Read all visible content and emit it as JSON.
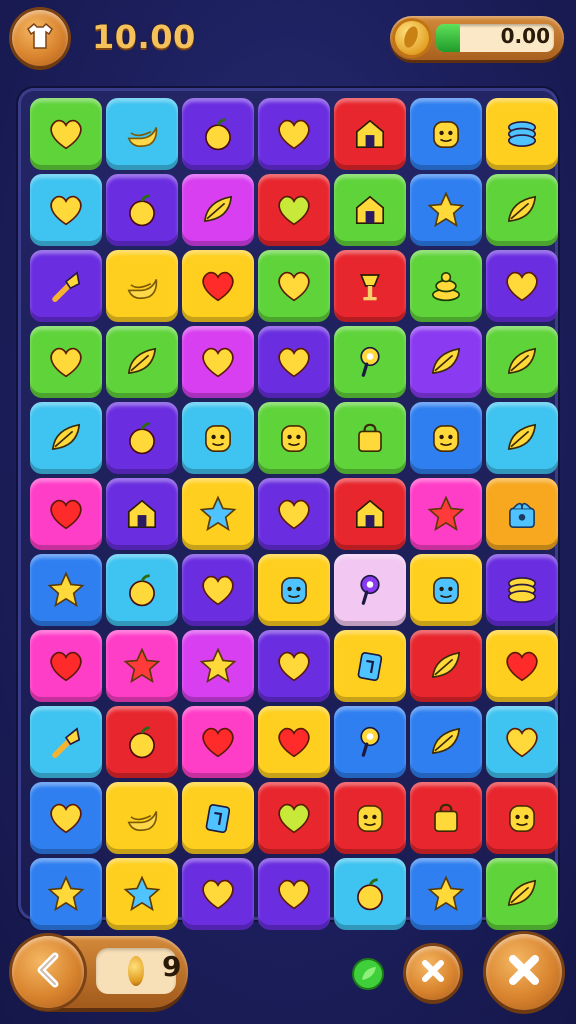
{
  "header": {
    "score": "10.00",
    "coins_value": "0.00",
    "coin_progress": 0.2
  },
  "footer": {
    "moves_remaining": "9"
  },
  "colors": {
    "green": "#5fd33a",
    "cyan": "#3fc3f0",
    "blue": "#2f7ff0",
    "purple": "#6a2ee0",
    "violet": "#8a3af0",
    "red": "#e8262e",
    "yellow": "#ffcf1f",
    "pink": "#ff3ec8",
    "magenta": "#d83ff0",
    "lightpink": "#f2c8f2",
    "orange": "#f7a81f"
  },
  "board": [
    [
      [
        "green",
        "heart"
      ],
      [
        "cyan",
        "banana"
      ],
      [
        "purple",
        "apple"
      ],
      [
        "purple",
        "heart"
      ],
      [
        "red",
        "house"
      ],
      [
        "blue",
        "face"
      ],
      [
        "yellow",
        "coil"
      ]
    ],
    [
      [
        "cyan",
        "heart"
      ],
      [
        "purple",
        "apple"
      ],
      [
        "magenta",
        "leaf"
      ],
      [
        "red",
        "heart"
      ],
      [
        "green",
        "house"
      ],
      [
        "blue",
        "star"
      ],
      [
        "green",
        "leaf"
      ]
    ],
    [
      [
        "purple",
        "wand"
      ],
      [
        "yellow",
        "banana"
      ],
      [
        "yellow",
        "heart"
      ],
      [
        "green",
        "heart"
      ],
      [
        "red",
        "lamp"
      ],
      [
        "green",
        "cake"
      ],
      [
        "purple",
        "heart"
      ]
    ],
    [
      [
        "green",
        "heart"
      ],
      [
        "green",
        "leaf"
      ],
      [
        "magenta",
        "heart"
      ],
      [
        "purple",
        "heart"
      ],
      [
        "green",
        "key"
      ],
      [
        "violet",
        "leaf"
      ],
      [
        "green",
        "leaf"
      ]
    ],
    [
      [
        "cyan",
        "leaf"
      ],
      [
        "purple",
        "apple"
      ],
      [
        "cyan",
        "face"
      ],
      [
        "green",
        "face"
      ],
      [
        "green",
        "bag"
      ],
      [
        "blue",
        "face"
      ],
      [
        "cyan",
        "leaf"
      ]
    ],
    [
      [
        "pink",
        "heart"
      ],
      [
        "purple",
        "house"
      ],
      [
        "yellow",
        "star"
      ],
      [
        "purple",
        "heart"
      ],
      [
        "red",
        "house"
      ],
      [
        "pink",
        "star"
      ],
      [
        "orange",
        "gift"
      ]
    ],
    [
      [
        "blue",
        "star"
      ],
      [
        "cyan",
        "apple"
      ],
      [
        "purple",
        "heart"
      ],
      [
        "yellow",
        "face"
      ],
      [
        "lightpink",
        "key"
      ],
      [
        "yellow",
        "face"
      ],
      [
        "purple",
        "coil"
      ]
    ],
    [
      [
        "pink",
        "heart"
      ],
      [
        "pink",
        "star"
      ],
      [
        "magenta",
        "star"
      ],
      [
        "purple",
        "heart"
      ],
      [
        "yellow",
        "card"
      ],
      [
        "red",
        "leaf"
      ],
      [
        "yellow",
        "heart"
      ]
    ],
    [
      [
        "cyan",
        "wand"
      ],
      [
        "red",
        "apple"
      ],
      [
        "pink",
        "heart"
      ],
      [
        "yellow",
        "heart"
      ],
      [
        "blue",
        "key"
      ],
      [
        "blue",
        "leaf"
      ],
      [
        "cyan",
        "heart"
      ]
    ],
    [
      [
        "blue",
        "heart"
      ],
      [
        "yellow",
        "banana"
      ],
      [
        "yellow",
        "card"
      ],
      [
        "red",
        "heart"
      ],
      [
        "red",
        "face"
      ],
      [
        "red",
        "bag"
      ],
      [
        "red",
        "face"
      ]
    ],
    [
      [
        "blue",
        "star"
      ],
      [
        "yellow",
        "star"
      ],
      [
        "purple",
        "heart"
      ],
      [
        "purple",
        "heart"
      ],
      [
        "cyan",
        "apple"
      ],
      [
        "blue",
        "star"
      ],
      [
        "green",
        "leaf"
      ]
    ]
  ]
}
